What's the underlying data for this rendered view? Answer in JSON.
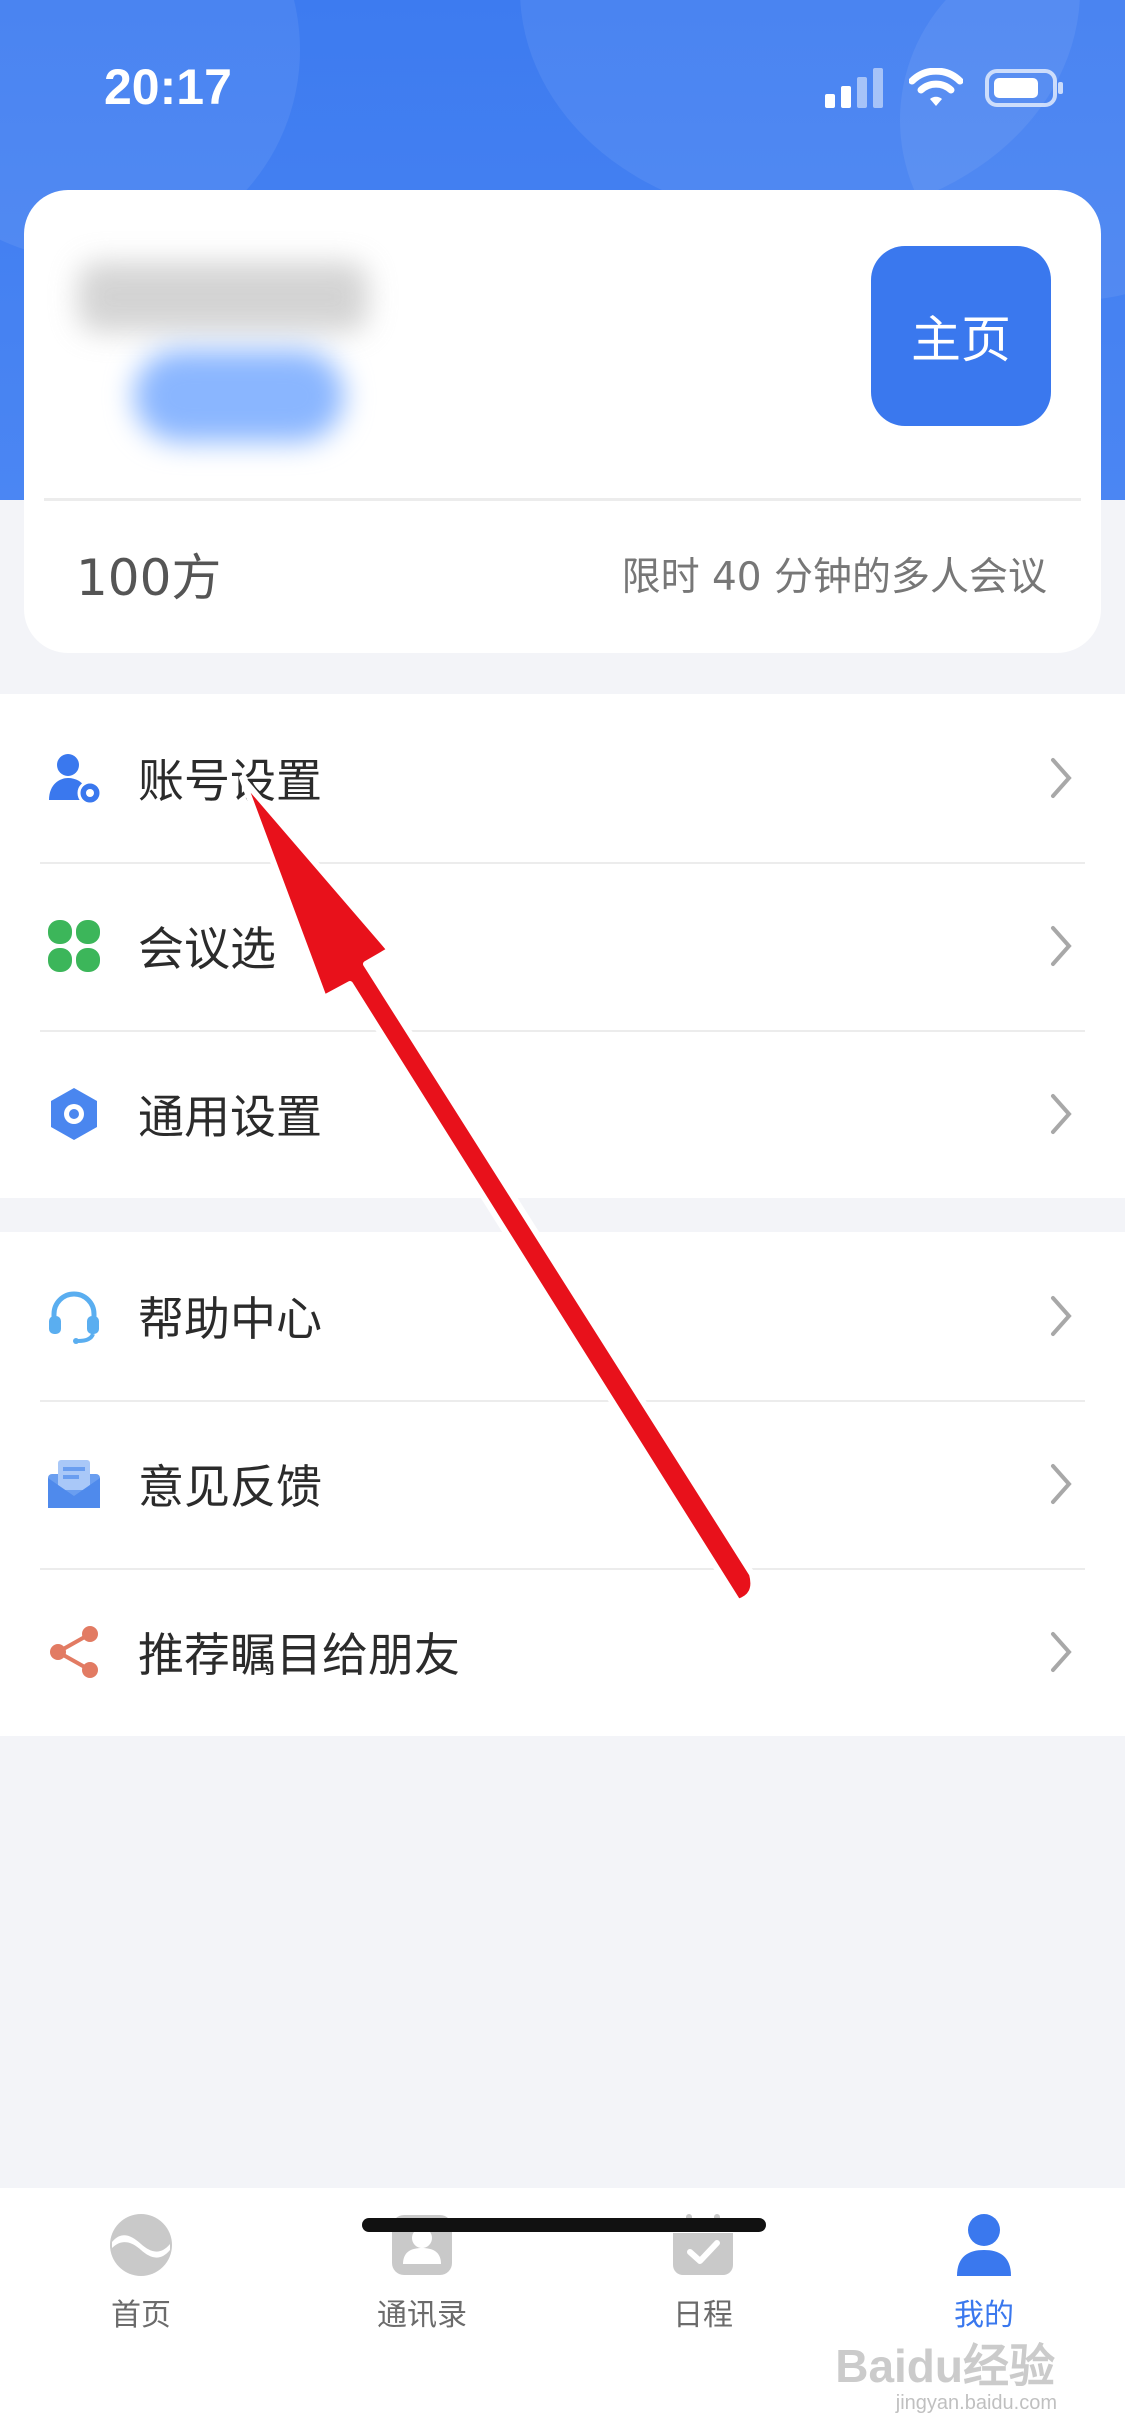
{
  "status_bar": {
    "time": "20:17"
  },
  "profile": {
    "home_button_label": "主页",
    "capacity": "100方",
    "capacity_desc": "限时 40 分钟的多人会议"
  },
  "menu_group_1": [
    {
      "label": "账号设置",
      "icon": "user-gear-icon"
    },
    {
      "label": "会议选",
      "icon": "clover-icon"
    },
    {
      "label": "通用设置",
      "icon": "hexagon-settings-icon"
    }
  ],
  "menu_group_2": [
    {
      "label": "帮助中心",
      "icon": "headset-icon"
    },
    {
      "label": "意见反馈",
      "icon": "mail-icon"
    },
    {
      "label": "推荐瞩目给朋友",
      "icon": "share-icon"
    }
  ],
  "tabs": [
    {
      "label": "首页",
      "icon": "home-logo-icon",
      "active": false
    },
    {
      "label": "通讯录",
      "icon": "contacts-icon",
      "active": false
    },
    {
      "label": "日程",
      "icon": "calendar-icon",
      "active": false
    },
    {
      "label": "我的",
      "icon": "person-icon",
      "active": true
    }
  ],
  "watermark": {
    "main": "Baidu经验",
    "sub": "jingyan.baidu.com"
  },
  "colors": {
    "accent": "#3a78ee",
    "header": "#3d7bf0",
    "arrow": "#e8111b"
  }
}
